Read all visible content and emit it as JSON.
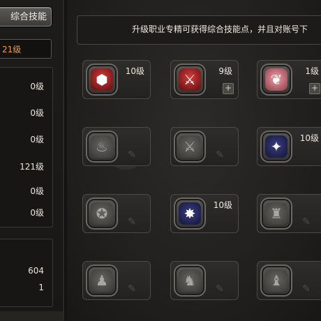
{
  "left_panel": {
    "title": "综合技能",
    "level_text": "21级",
    "stats": [
      "0级",
      "0级",
      "0级",
      "121级",
      "0级",
      "0级"
    ],
    "counters": [
      "604",
      "1"
    ]
  },
  "main": {
    "hint": "升级职业专精可获得综合技能点，并且对账号下",
    "skills": [
      {
        "level": "10级",
        "icon": "gift-icon",
        "glyph": "⬢"
      },
      {
        "level": "9级",
        "icon": "sword-icon",
        "glyph": "⚔"
      },
      {
        "level": "1级",
        "icon": "feather-icon",
        "glyph": "❦"
      },
      {
        "level": "",
        "icon": "flame-icon",
        "glyph": "♨"
      },
      {
        "level": "",
        "icon": "blade-icon",
        "glyph": "⚔"
      },
      {
        "level": "10级",
        "icon": "wings-icon",
        "glyph": "✦"
      },
      {
        "level": "",
        "icon": "shield-icon",
        "glyph": "✪"
      },
      {
        "level": "10级",
        "icon": "star-burst-icon",
        "glyph": "✸"
      },
      {
        "level": "",
        "icon": "helmet-icon",
        "glyph": "♜"
      },
      {
        "level": "",
        "icon": "warrior-icon",
        "glyph": "♟"
      },
      {
        "level": "",
        "icon": "runner-icon",
        "glyph": "♞"
      },
      {
        "level": "",
        "icon": "statue-icon",
        "glyph": "♝"
      }
    ]
  }
}
